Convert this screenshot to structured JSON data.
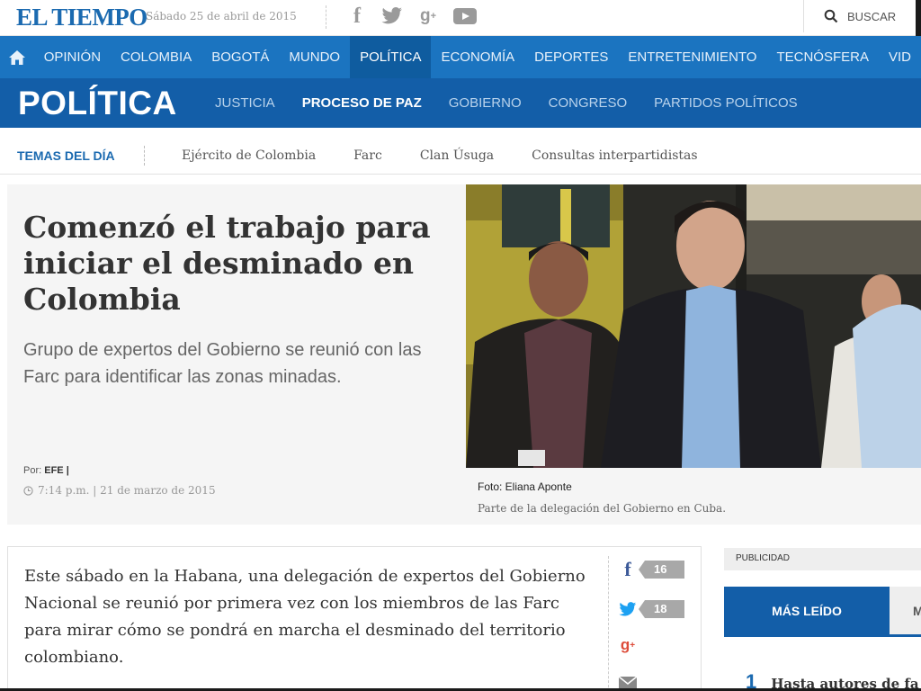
{
  "site": {
    "logo": "EL TIEMPO",
    "date": "Sábado 25 de abril de 2015",
    "search_label": "BUSCAR"
  },
  "main_nav": {
    "items": [
      "OPINIÓN",
      "COLOMBIA",
      "BOGOTÁ",
      "MUNDO",
      "POLÍTICA",
      "ECONOMÍA",
      "DEPORTES",
      "ENTRETENIMIENTO",
      "TECNÓSFERA",
      "VID"
    ],
    "active": "POLÍTICA"
  },
  "section": {
    "title": "POLÍTICA",
    "subnav": [
      "JUSTICIA",
      "PROCESO DE PAZ",
      "GOBIERNO",
      "CONGRESO",
      "PARTIDOS POLÍTICOS"
    ],
    "active": "PROCESO DE PAZ"
  },
  "temas": {
    "label": "TEMAS DEL DÍA",
    "items": [
      "Ejército de Colombia",
      "Farc",
      "Clan Úsuga",
      "Consultas interpartidistas"
    ]
  },
  "hero": {
    "headline": "Comenzó el trabajo para iniciar el desminado en Colombia",
    "summary": "Grupo de expertos del Gobierno se reunió con las Farc para identificar las zonas minadas.",
    "byline_prefix": "Por:",
    "byline_author": "EFE |",
    "timestamp": "7:14 p.m. | 21 de marzo de 2015",
    "photo_credit": "Foto: Eliana Aponte",
    "photo_caption": "Parte de la delegación del Gobierno en Cuba."
  },
  "article": {
    "body": "Este sábado en la Habana, una delegación de expertos del Gobierno Nacional se reunió por primera vez con los miembros de las Farc para mirar cómo se pondrá en marcha el desminado del territorio colombiano.",
    "shares": {
      "facebook": "16",
      "twitter": "18"
    }
  },
  "sidebar": {
    "publicidad": "PUBLICIDAD",
    "tab_active": "MÁS LEÍDO",
    "tab_other": "M",
    "top_item_number": "1",
    "top_item_title": "Hasta autores de fa"
  },
  "colors": {
    "brand_blue": "#1b74c0",
    "section_blue": "#135ea8",
    "twitter": "#1da1f2",
    "facebook": "#3b5998",
    "googleplus": "#dd4b39"
  }
}
